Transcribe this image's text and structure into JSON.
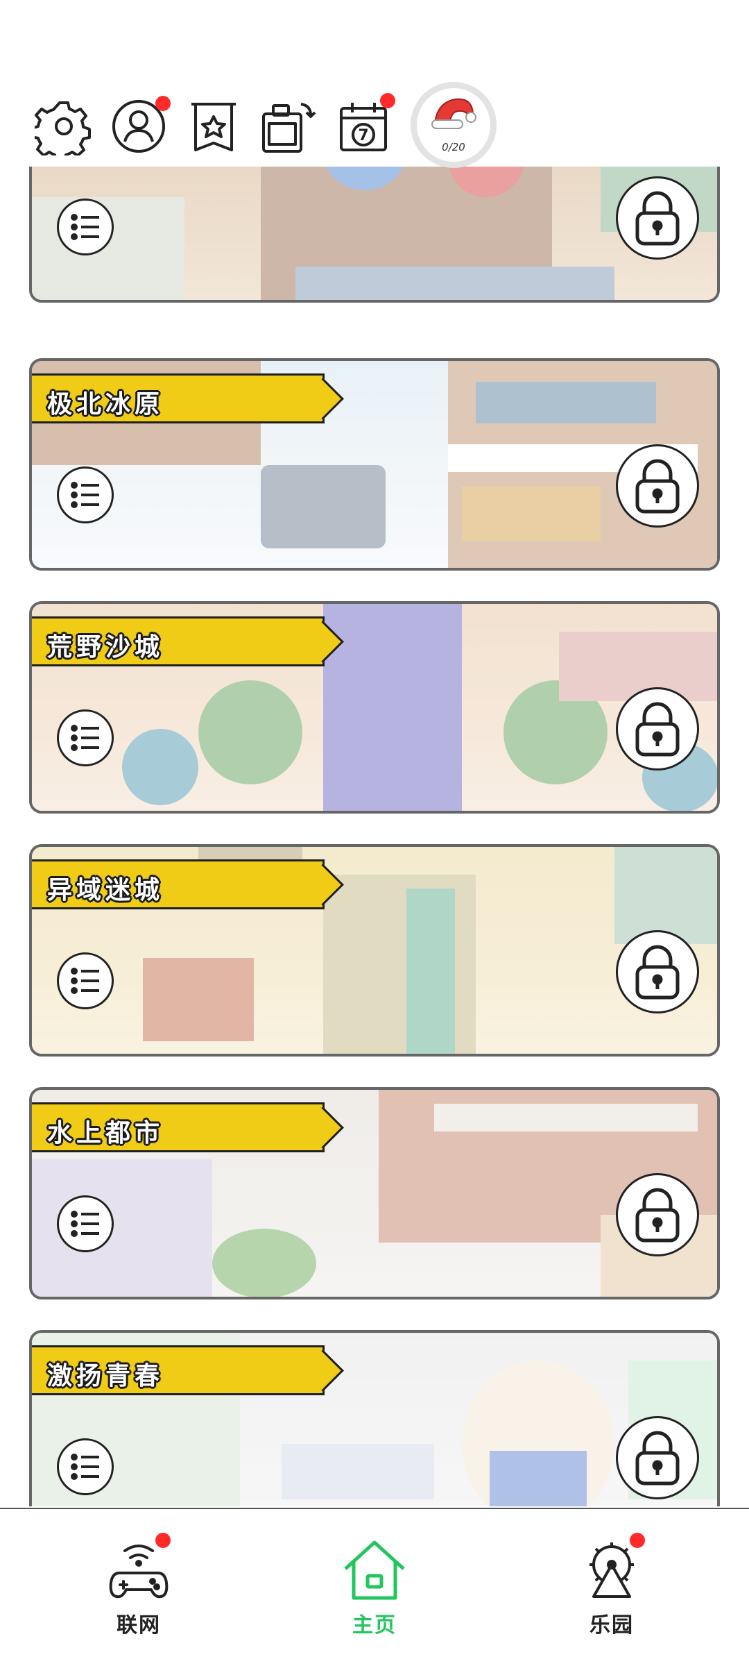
{
  "toolbar": {
    "items": [
      {
        "name": "settings",
        "icon": "gear-icon",
        "badge": false
      },
      {
        "name": "profile",
        "icon": "user-icon",
        "badge": true
      },
      {
        "name": "bookmarks",
        "icon": "star-bookmark-icon",
        "badge": false
      },
      {
        "name": "devices",
        "icon": "device-swap-icon",
        "badge": false
      },
      {
        "name": "calendar",
        "icon": "calendar-icon",
        "calendar_day": "7",
        "badge": true
      }
    ],
    "hat_counter": {
      "icon": "christmas-hat-icon",
      "value": "0/20"
    }
  },
  "levels": [
    {
      "title": "",
      "theme": "opera stage",
      "locked": true
    },
    {
      "title": "极北冰原",
      "theme": "snow village",
      "locked": true
    },
    {
      "title": "荒野沙城",
      "theme": "desert palace",
      "locked": true
    },
    {
      "title": "异域迷城",
      "theme": "egyptian temple",
      "locked": true
    },
    {
      "title": "水上都市",
      "theme": "water city",
      "locked": true
    },
    {
      "title": "激扬青春",
      "theme": "sports field",
      "locked": true
    }
  ],
  "bottom_nav": {
    "items": [
      {
        "label": "联网",
        "icon": "gamepad-wifi-icon",
        "active": false,
        "badge": true
      },
      {
        "label": "主页",
        "icon": "home-icon",
        "active": true,
        "badge": false
      },
      {
        "label": "乐园",
        "icon": "ferris-wheel-icon",
        "active": false,
        "badge": true
      }
    ]
  },
  "colors": {
    "banner": "#f0cc17",
    "active": "#22c55e",
    "badge": "#ff2a2a",
    "card_border": "#666666"
  }
}
